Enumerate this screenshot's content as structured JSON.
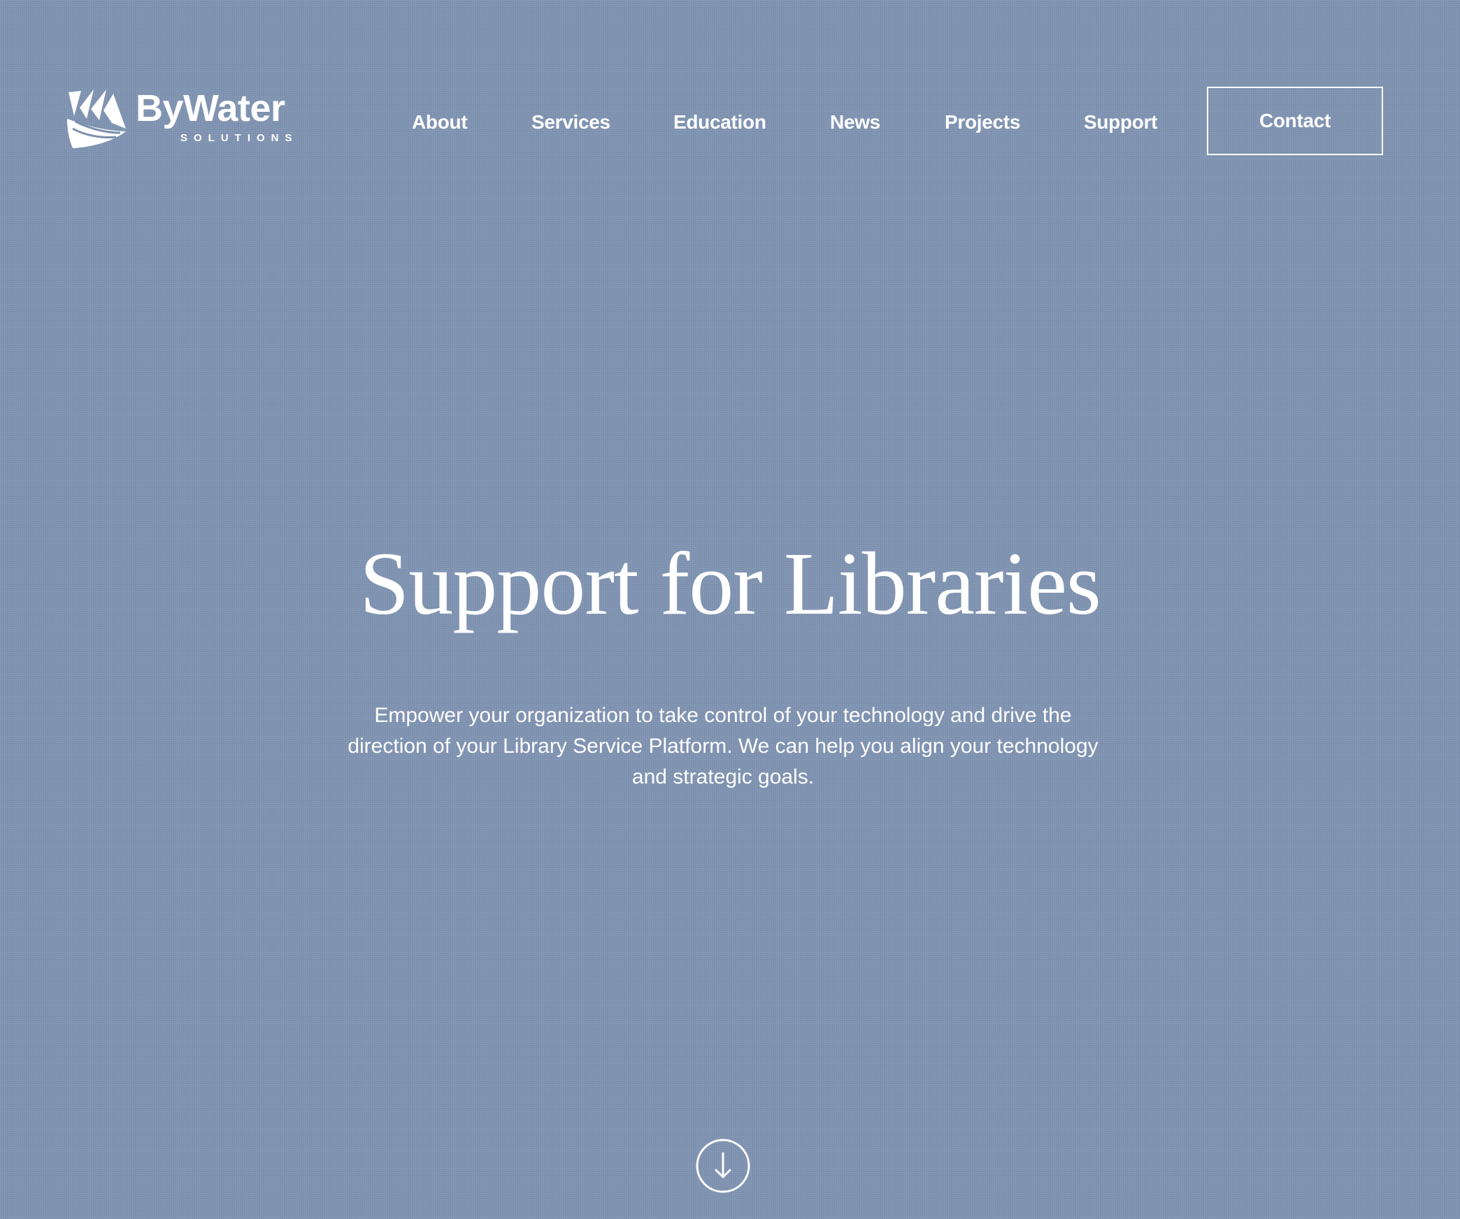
{
  "brand": {
    "name": "ByWater",
    "tagline": "SOLUTIONS",
    "logo_icon": "bywater-sail-logo-icon"
  },
  "nav": {
    "items": [
      {
        "label": "About"
      },
      {
        "label": "Services"
      },
      {
        "label": "Education"
      },
      {
        "label": "News"
      },
      {
        "label": "Projects"
      },
      {
        "label": "Support"
      }
    ],
    "contact_label": "Contact"
  },
  "hero": {
    "title": "Support for Libraries",
    "description": "Empower your organization to take control of your technology and drive the direction of your Library Service Platform. We can help you align your technology and strategic goals.",
    "scroll_icon": "arrow-down-circle-icon"
  },
  "colors": {
    "background": "#7b8fae",
    "text": "#ffffff"
  }
}
